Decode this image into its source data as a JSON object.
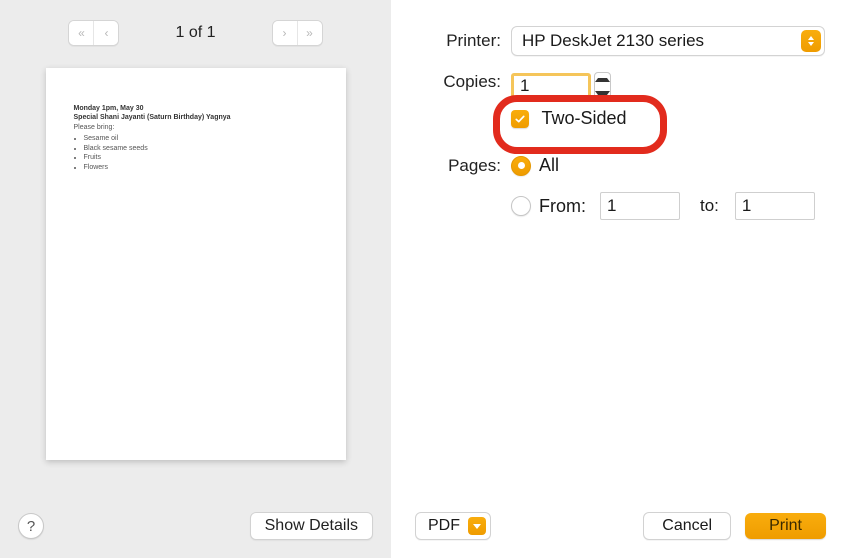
{
  "nav": {
    "page_indicator": "1 of 1"
  },
  "preview": {
    "line1": "Monday 1pm, May 30",
    "line2": "Special Shani Jayanti (Saturn Birthday) Yagnya",
    "line3": "Please bring:",
    "items": [
      "Sesame oil",
      "Black sesame seeds",
      "Fruits",
      "Flowers"
    ]
  },
  "printer": {
    "label": "Printer:",
    "value": "HP DeskJet 2130 series"
  },
  "copies": {
    "label": "Copies:",
    "value": "1",
    "two_sided_label": "Two-Sided"
  },
  "pages": {
    "label": "Pages:",
    "all_label": "All",
    "from_label": "From:",
    "to_label": "to:",
    "from_value": "1",
    "to_value": "1"
  },
  "footer": {
    "help_glyph": "?",
    "show_details": "Show Details",
    "pdf": "PDF",
    "cancel": "Cancel",
    "print": "Print"
  }
}
